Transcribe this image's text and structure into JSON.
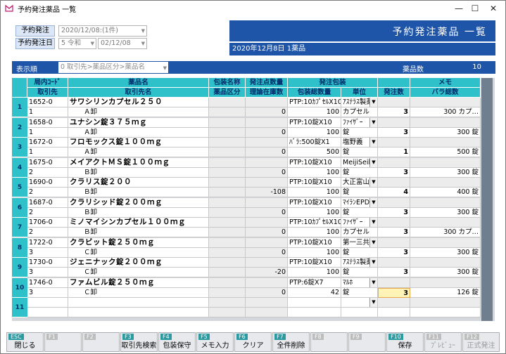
{
  "window": {
    "title": "予約発注薬品 一覧"
  },
  "header": {
    "order_label": "予約発注",
    "order_value": "2020/12/08:(1件)",
    "date_label": "予約発注日",
    "era_value": "5 令和",
    "date_value": "02/12/08",
    "banner_title": "予約発注薬品 一覧",
    "banner_sub": "2020年12月8日 1薬品"
  },
  "sortbar": {
    "label": "表示順",
    "value": "0 取引先>薬品区分>薬品名",
    "count_label": "薬品数",
    "count_value": "10"
  },
  "columns": {
    "h1": [
      "局内ｺｰﾄﾞ",
      "薬品名",
      "包装名称",
      "発注点数量",
      "発注包装",
      "",
      "メモ"
    ],
    "h2": [
      "取引先",
      "取引先名",
      "薬品区分",
      "理論在庫数",
      "包装総数量",
      "単位",
      "発注数",
      "バラ総数"
    ]
  },
  "rows": [
    {
      "n": "1",
      "code": "1652-0",
      "name": "サワシリンカプセル２５０",
      "pkg": "PTP:10ｶﾌﾟｾﾙX10",
      "maker": "ｱｽﾃﾗｽ製薬",
      "sup": "1",
      "supname": "Ａ卸",
      "stock": "0",
      "qty": "100",
      "unit": "カプセル",
      "order": "3",
      "bara": "300 カプ…"
    },
    {
      "n": "2",
      "code": "1658-0",
      "name": "ユナシン錠３７５ｍｇ",
      "pkg": "PTP:10錠X10",
      "maker": "ﾌｧｲｻﾞｰ",
      "sup": "1",
      "supname": "Ａ卸",
      "stock": "0",
      "qty": "100",
      "unit": "錠",
      "order": "3",
      "bara": "300 錠"
    },
    {
      "n": "3",
      "code": "1672-0",
      "name": "フロモックス錠１００ｍｇ",
      "pkg": "ﾊﾞﾗ:500錠X1",
      "maker": "塩野義",
      "sup": "1",
      "supname": "Ａ卸",
      "stock": "0",
      "qty": "500",
      "unit": "錠",
      "order": "1",
      "bara": "500 錠"
    },
    {
      "n": "4",
      "code": "1675-0",
      "name": "メイアクトＭＳ錠１００ｍｇ",
      "pkg": "PTP:10錠X10",
      "maker": "MeijiSeikaﾌ",
      "sup": "2",
      "supname": "Ｂ卸",
      "stock": "0",
      "qty": "100",
      "unit": "錠",
      "order": "3",
      "bara": "300 錠"
    },
    {
      "n": "5",
      "code": "1690-0",
      "name": "クラリス錠２００",
      "pkg": "PTP:10錠X10",
      "maker": "大正富山医ｽ",
      "sup": "2",
      "supname": "Ｂ卸",
      "stock": "-108",
      "qty": "100",
      "unit": "錠",
      "order": "4",
      "bara": "400 錠"
    },
    {
      "n": "6",
      "code": "1687-0",
      "name": "クラリシッド錠２００ｍｇ",
      "pkg": "PTP:10錠X10",
      "maker": "ﾏｲﾗﾝEPD",
      "sup": "2",
      "supname": "Ｂ卸",
      "stock": "0",
      "qty": "100",
      "unit": "錠",
      "order": "3",
      "bara": "300 錠"
    },
    {
      "n": "7",
      "code": "1706-0",
      "name": "ミノマイシンカプセル１００ｍｇ",
      "pkg": "PTP:10ｶﾌﾟｾﾙX10",
      "maker": "ﾌｧｲｻﾞｰ",
      "sup": "2",
      "supname": "Ｂ卸",
      "stock": "0",
      "qty": "100",
      "unit": "カプセル",
      "order": "3",
      "bara": "300 カプ…"
    },
    {
      "n": "8",
      "code": "1722-0",
      "name": "クラビット錠２５０ｍｇ",
      "pkg": "PTP:10錠X10",
      "maker": "第一三共",
      "sup": "3",
      "supname": "Ｃ卸",
      "stock": "0",
      "qty": "100",
      "unit": "錠",
      "order": "3",
      "bara": "300 錠"
    },
    {
      "n": "9",
      "code": "1730-0",
      "name": "ジェニナック錠２００ｍｇ",
      "pkg": "PTP:10錠X10",
      "maker": "ｱｽﾃﾗｽ製薬",
      "sup": "3",
      "supname": "Ｃ卸",
      "stock": "-20",
      "qty": "100",
      "unit": "錠",
      "order": "3",
      "bara": "300 錠"
    },
    {
      "n": "10",
      "code": "1746-0",
      "name": "ファムビル錠２５０ｍｇ",
      "pkg": "PTP:6錠X7",
      "maker": "ﾏﾙﾎ",
      "sup": "3",
      "supname": "Ｃ卸",
      "stock": "0",
      "qty": "42",
      "unit": "錠",
      "order": "3",
      "bara": "126 錠"
    },
    {
      "n": "11",
      "code": "",
      "name": "",
      "pkg": "",
      "maker": "",
      "sup": "",
      "supname": "",
      "stock": "",
      "qty": "",
      "unit": "",
      "order": "",
      "bara": ""
    }
  ],
  "fkeys": [
    {
      "num": "ESC",
      "label": "閉じる",
      "enabled": true
    },
    {
      "num": "F1",
      "label": "",
      "enabled": false
    },
    {
      "num": "F2",
      "label": "",
      "enabled": false
    },
    {
      "num": "F3",
      "label": "取引先検索",
      "enabled": true
    },
    {
      "num": "F4",
      "label": "包装保守",
      "enabled": true
    },
    {
      "num": "F5",
      "label": "メモ入力",
      "enabled": true
    },
    {
      "num": "F6",
      "label": "クリア",
      "enabled": true
    },
    {
      "num": "F7",
      "label": "全件削除",
      "enabled": true
    },
    {
      "num": "F8",
      "label": "",
      "enabled": false
    },
    {
      "num": "F9",
      "label": "",
      "enabled": false
    },
    {
      "num": "F10",
      "label": "保存",
      "enabled": true
    },
    {
      "num": "F11",
      "label": "ﾌﾟﾚﾋﾞｭｰ",
      "enabled": false
    },
    {
      "num": "F12",
      "label": "正式発注",
      "enabled": false
    }
  ]
}
